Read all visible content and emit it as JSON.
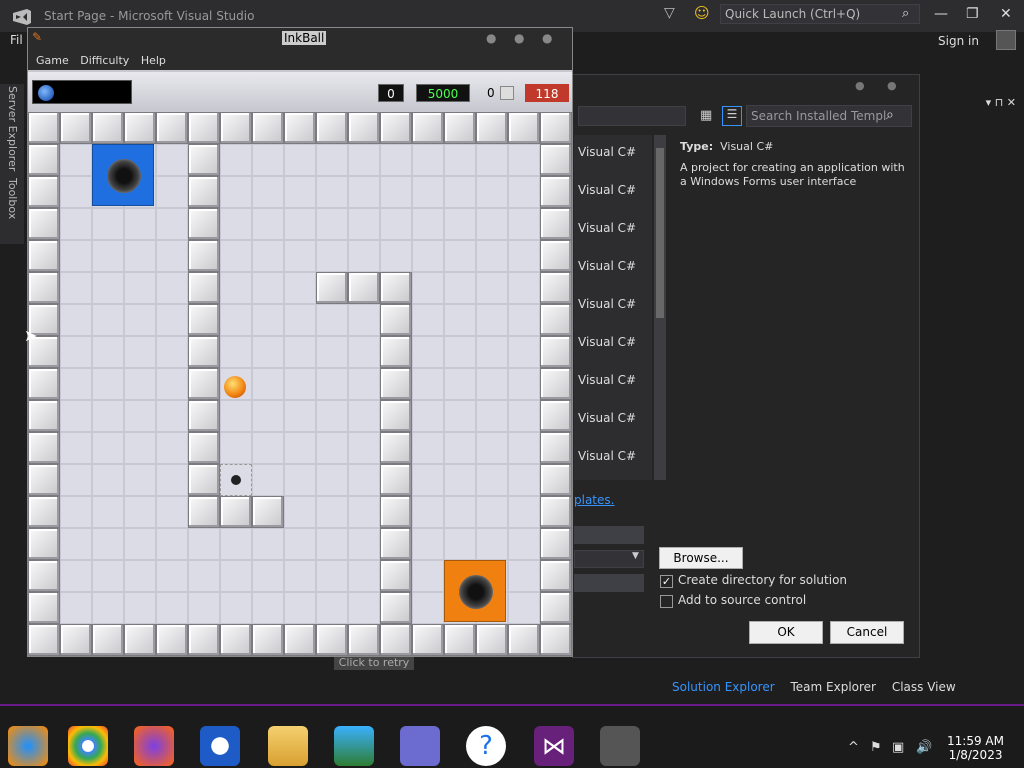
{
  "vs": {
    "title": "Start Page - Microsoft Visual Studio",
    "menu_first": "Fil",
    "quick_launch": "Quick Launch (Ctrl+Q)",
    "sign_in": "Sign in",
    "side_tabs": [
      "Server Explorer",
      "Toolbox"
    ]
  },
  "dialog": {
    "search_placeholder": "Search Installed Templ",
    "templates": [
      "Visual C#",
      "Visual C#",
      "Visual C#",
      "Visual C#",
      "Visual C#",
      "Visual C#",
      "Visual C#",
      "Visual C#",
      "Visual C#"
    ],
    "type_label": "Type:",
    "type_value": "Visual C#",
    "description": "A project for creating an application with a Windows Forms user interface",
    "link": "plates.",
    "browse": "Browse...",
    "create_dir": "Create directory for solution",
    "create_dir_checked": true,
    "source_control": "Add to source control",
    "source_control_checked": false,
    "ok": "OK",
    "cancel": "Cancel"
  },
  "bottom_tabs": [
    "Solution Explorer",
    "Team Explorer",
    "Class View"
  ],
  "inkball": {
    "title": "InkBall",
    "menu": [
      "Game",
      "Difficulty",
      "Help"
    ],
    "score": "0",
    "points": "5000",
    "count": "0",
    "time": "118",
    "retry": "Click to retry"
  },
  "taskbar": {
    "apps": [
      "media-player-icon",
      "chrome-icon",
      "firefox-icon",
      "obama-icon",
      "file-explorer-icon",
      "network-icon",
      "character-icon",
      "help-icon",
      "visual-studio-icon",
      "inkball-icon"
    ],
    "time": "11:59 AM",
    "date": "1/8/2023"
  },
  "colors": {
    "accent": "#6a1b8a",
    "blue_hole": "#1f6fe0",
    "orange_hole": "#f08010",
    "time_box": "#c0392b"
  }
}
